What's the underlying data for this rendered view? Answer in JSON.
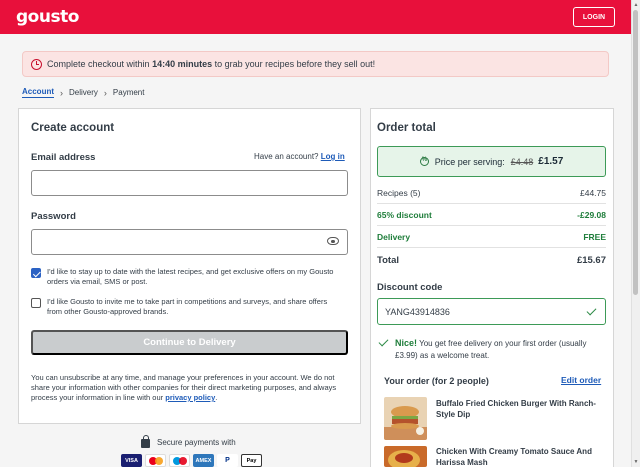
{
  "header": {
    "logo": "gousto",
    "login_label": "LOGIN"
  },
  "banner": {
    "prefix": "Complete checkout within ",
    "time": "14:40 minutes",
    "suffix": " to grab your recipes before they sell out!"
  },
  "breadcrumb": {
    "steps": [
      "Account",
      "Delivery",
      "Payment"
    ]
  },
  "account": {
    "title": "Create account",
    "email_label": "Email address",
    "have_account": "Have an account?",
    "login_link": "Log in",
    "email_value": "",
    "password_label": "Password",
    "password_value": "",
    "opt_in_1": "I'd like to stay up to date with the latest recipes, and get exclusive offers on my Gousto orders via email, SMS or post.",
    "opt_in_1_checked": true,
    "opt_in_2": "I'd like Gousto to invite me to take part in competitions and surveys, and share offers from other Gousto-approved brands.",
    "opt_in_2_checked": false,
    "continue_label": "Continue to Delivery",
    "disclaimer": "You can unsubscribe at any time, and manage your preferences in your account. We do not share your information with other companies for their direct marketing purposes, and always process your information in line with our ",
    "privacy_link": "privacy policy",
    "disclaimer_end": "."
  },
  "secure": {
    "label": "Secure payments with",
    "methods": [
      "VISA",
      "Mastercard",
      "Maestro",
      "AMEX",
      "PayPal",
      "Apple Pay"
    ]
  },
  "order": {
    "title": "Order total",
    "price_per_serving_label": "Price per serving:",
    "old_price": "£4.48",
    "new_price": "£1.57",
    "recipes_label": "Recipes (5)",
    "recipes_value": "£44.75",
    "discount_label": "65% discount",
    "discount_value": "-£29.08",
    "delivery_label": "Delivery",
    "delivery_value": "FREE",
    "total_label": "Total",
    "total_value": "£15.67",
    "discount_code_label": "Discount code",
    "discount_code_value": "YANG43914836",
    "nice_label": "Nice!",
    "nice_text": " You get free delivery on your first order (usually £3.99) as a welcome treat.",
    "your_order_label": "Your order (for 2 people)",
    "edit_order_label": "Edit order",
    "recipes": [
      "Buffalo Fried Chicken Burger With Ranch-Style Dip",
      "Chicken With Creamy Tomato Sauce And Harissa Mash"
    ]
  },
  "colors": {
    "brand": "#e8103b",
    "link": "#1e5bb8",
    "success": "#1e7d3a"
  }
}
